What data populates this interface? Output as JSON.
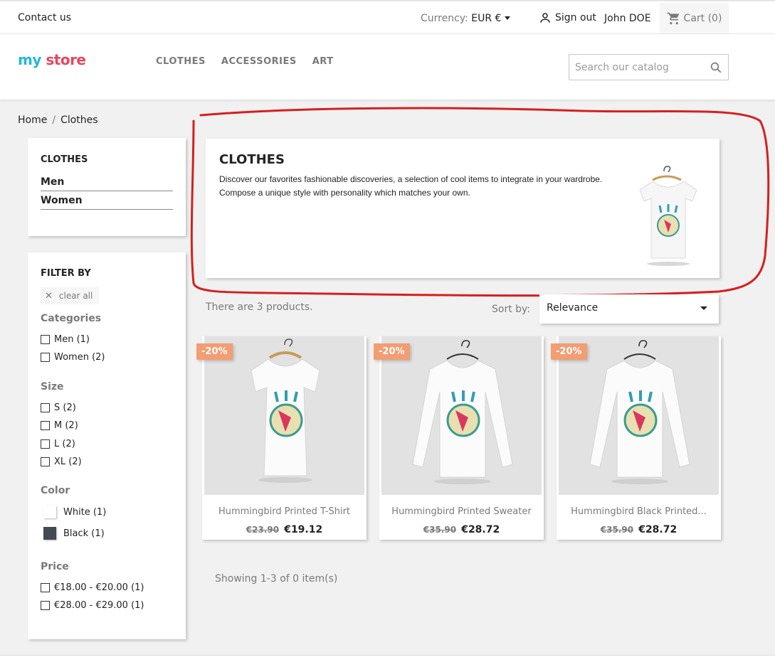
{
  "topbar": {
    "contact": "Contact us",
    "currency_label": "Currency:",
    "currency_value": "EUR €",
    "signout": "Sign out",
    "user_name": "John DOE",
    "cart": "Cart (0)"
  },
  "header": {
    "logo_my": "my",
    "logo_store": "store",
    "nav": [
      "CLOTHES",
      "ACCESSORIES",
      "ART"
    ],
    "search_placeholder": "Search our catalog"
  },
  "breadcrumb": {
    "home": "Home",
    "separator": "/",
    "current": "Clothes"
  },
  "categories_block": {
    "title": "CLOTHES",
    "items": [
      "Men",
      "Women"
    ]
  },
  "filters": {
    "title": "FILTER BY",
    "clear_all": "clear all",
    "categories": {
      "title": "Categories",
      "options": [
        "Men (1)",
        "Women (2)"
      ]
    },
    "size": {
      "title": "Size",
      "options": [
        "S (2)",
        "M (2)",
        "L (2)",
        "XL (2)"
      ]
    },
    "color": {
      "title": "Color",
      "options": [
        {
          "label": "White (1)",
          "color": "#ffffff"
        },
        {
          "label": "Black (1)",
          "color": "#434a54"
        }
      ]
    },
    "price": {
      "title": "Price",
      "options": [
        "€18.00 - €20.00 (1)",
        "€28.00 - €29.00 (1)"
      ]
    }
  },
  "category_header": {
    "title": "CLOTHES",
    "description": "Discover our favorites fashionable discoveries, a selection of cool items to integrate in your wardrobe. Compose a unique style with personality which matches your own."
  },
  "listing": {
    "count_text": "There are 3 products.",
    "sort_label": "Sort by:",
    "sort_value": "Relevance",
    "showing": "Showing 1-3 of 0 item(s)"
  },
  "products": [
    {
      "name": "Hummingbird Printed T-Shirt",
      "old_price": "€23.90",
      "price": "€19.12",
      "badge": "-20%",
      "kind": "tshirt"
    },
    {
      "name": "Hummingbird Printed Sweater",
      "old_price": "€35.90",
      "price": "€28.72",
      "badge": "-20%",
      "kind": "sweater"
    },
    {
      "name": "Hummingbird Black Printed...",
      "old_price": "€35.90",
      "price": "€28.72",
      "badge": "-20%",
      "kind": "sweater"
    }
  ],
  "colors": {
    "accent": "#24b9d7",
    "badge": "#f39d72",
    "annotation": "#d61f1f"
  }
}
